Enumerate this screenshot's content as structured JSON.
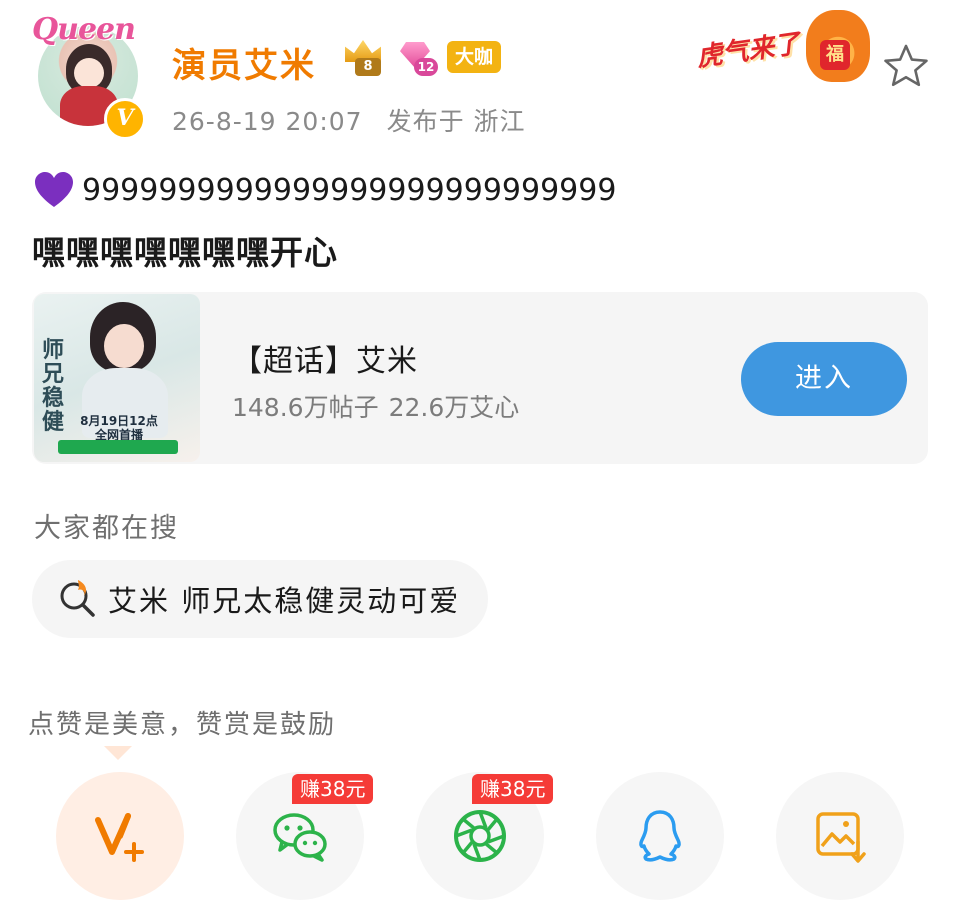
{
  "header": {
    "avatar_overlay_text": "Queen",
    "username": "演员艾米",
    "crown_level": "8",
    "diamond_level": "12",
    "badge_dakai": "大咖",
    "post_date": "26-8-19 20:07",
    "post_location": "发布于 浙江",
    "decor_text": "虎气来了",
    "decor_fu": "福"
  },
  "post": {
    "line1": "9999999999999999999999999999",
    "line2": "嘿嘿嘿嘿嘿嘿嘿开心"
  },
  "topic_card": {
    "title": "【超话】艾米",
    "posts_count": "148.6万帖子",
    "fans_count": "22.6万艾心",
    "enter_label": "进入",
    "thumb_calligraphy": "师兄稳健",
    "thumb_date": "8月19日12点\n全网首播"
  },
  "search": {
    "section_title": "大家都在搜",
    "hot_query": "艾米 师兄太稳健灵动可爱"
  },
  "reward": {
    "tip_text": "点赞是美意，赞赏是鼓励",
    "wechat_earn": "赚38元",
    "moments_earn": "赚38元"
  },
  "colors": {
    "username": "#f07b00",
    "enter_button": "#3f97e0",
    "earn_badge": "#f53b37",
    "wechat_green": "#2cb34a",
    "qq_blue": "#2b9cf0",
    "save_orange": "#f0a11a"
  }
}
